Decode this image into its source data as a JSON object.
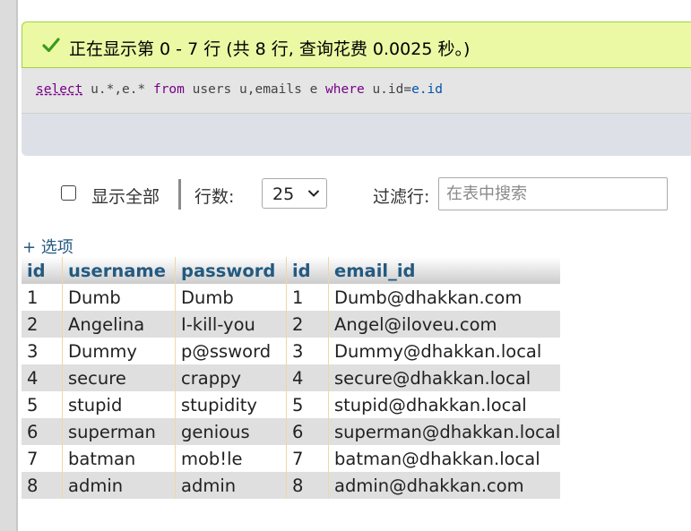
{
  "success": {
    "message": "正在显示第 0 - 7 行 (共 8 行, 查询花费 0.0025 秒。)",
    "icon": "check-icon",
    "color": "#ebf8a4"
  },
  "sql": {
    "select": "select",
    "cols": "u.*,e.*",
    "from": "from",
    "tables": "users u,emails e",
    "where": "where",
    "left": "u.id",
    "eq": "=",
    "right": "e.id"
  },
  "nav": {
    "show_all": "显示全部",
    "rows_label": "行数:",
    "rows_value": "25",
    "filter_label": "过滤行:",
    "filter_placeholder": "在表中搜索"
  },
  "options_link": "+ 选项",
  "table": {
    "headers": [
      "id",
      "username",
      "password",
      "id",
      "email_id"
    ],
    "rows": [
      [
        "1",
        "Dumb",
        "Dumb",
        "1",
        "Dumb@dhakkan.com"
      ],
      [
        "2",
        "Angelina",
        "I-kill-you",
        "2",
        "Angel@iloveu.com"
      ],
      [
        "3",
        "Dummy",
        "p@ssword",
        "3",
        "Dummy@dhakkan.local"
      ],
      [
        "4",
        "secure",
        "crappy",
        "4",
        "secure@dhakkan.local"
      ],
      [
        "5",
        "stupid",
        "stupidity",
        "5",
        "stupid@dhakkan.local"
      ],
      [
        "6",
        "superman",
        "genious",
        "6",
        "superman@dhakkan.local"
      ],
      [
        "7",
        "batman",
        "mob!le",
        "7",
        "batman@dhakkan.local"
      ],
      [
        "8",
        "admin",
        "admin",
        "8",
        "admin@dhakkan.com"
      ]
    ]
  }
}
